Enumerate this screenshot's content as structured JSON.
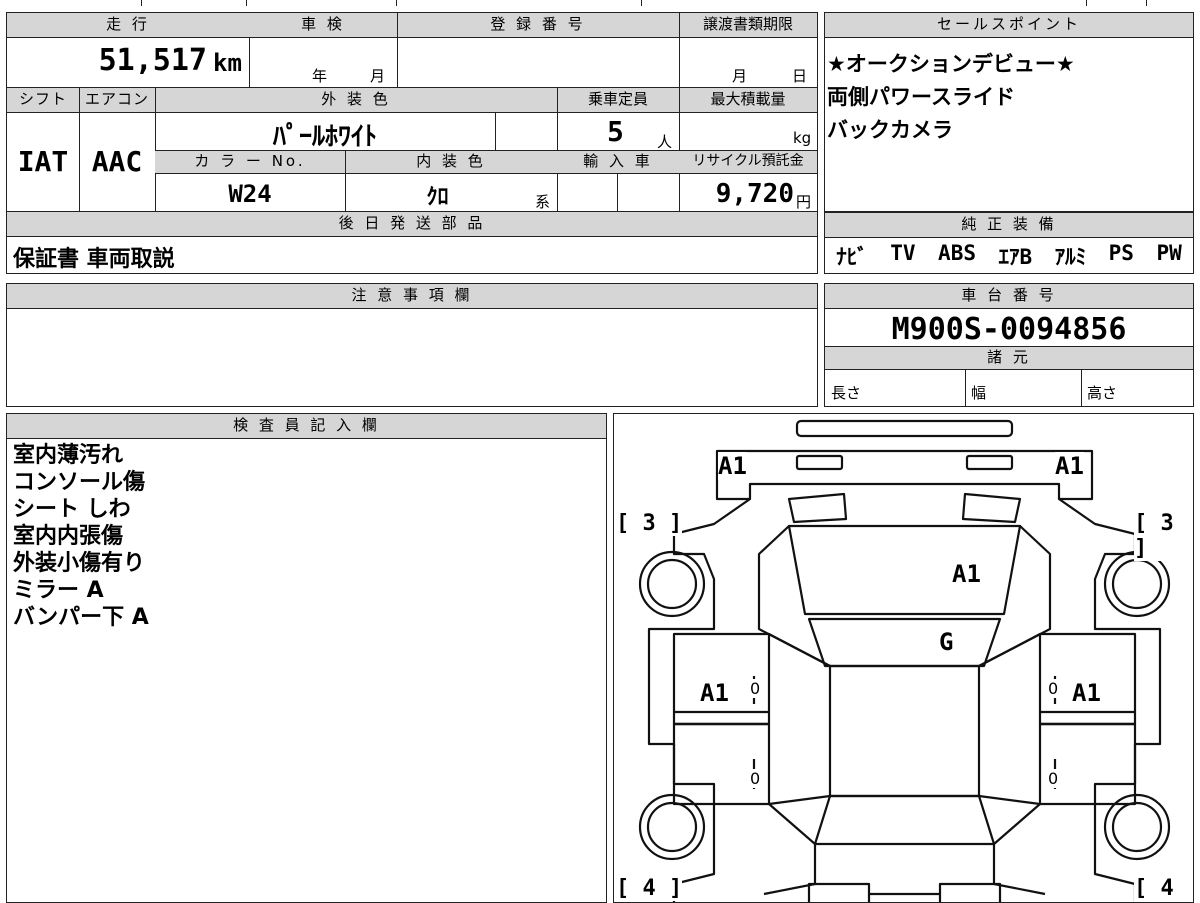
{
  "top": {
    "mileage_label": "走 行",
    "mileage_value": "51,517",
    "mileage_unit": "km",
    "shaken_label": "車 検",
    "shaken_year": "年",
    "shaken_month": "月",
    "reg_label": "登 録 番 号",
    "transfer_label": "譲渡書類期限",
    "transfer_month": "月",
    "transfer_day": "日",
    "shift_label": "シフト",
    "shift_value": "IAT",
    "ac_label": "エアコン",
    "ac_value": "AAC",
    "ext_color_label": "外 装 色",
    "ext_color_value": "ﾊﾟｰﾙﾎﾜｲﾄ",
    "capacity_label": "乗車定員",
    "capacity_value": "5",
    "capacity_unit": "人",
    "max_load_label": "最大積載量",
    "max_load_unit": "kg",
    "color_no_label": "カ ラ ー No.",
    "color_no_value": "W24",
    "int_color_label": "内 装 色",
    "int_color_value": "ｸﾛ",
    "int_color_suffix": "系",
    "import_label": "輸 入 車",
    "recycle_label": "リサイクル預託金",
    "recycle_value": "9,720",
    "recycle_unit": "円",
    "later_parts_label": "後 日 発 送 部 品",
    "later_parts_value": "保証書 車両取説"
  },
  "sales": {
    "label": "セールスポイント",
    "lines": [
      "★オークションデビュー★",
      "両側パワースライド",
      "バックカメラ"
    ]
  },
  "equipment": {
    "label": "純 正 装 備",
    "items": [
      "ﾅﾋﾞ",
      "TV",
      "ABS",
      "ｴｱB",
      "ｱﾙﾐ",
      "PS",
      "PW"
    ]
  },
  "caution": {
    "label": "注 意 事 項 欄"
  },
  "chassis": {
    "label": "車 台 番 号",
    "value": "M900S-0094856",
    "spec_label": "諸 元",
    "length_label": "長さ",
    "width_label": "幅",
    "height_label": "高さ"
  },
  "inspector": {
    "label": "検 査 員 記 入 欄",
    "notes": [
      "室内薄汚れ",
      "コンソール傷",
      "シート しわ",
      "室内内張傷",
      "外装小傷有り",
      "ミラー A",
      "バンパー下 A"
    ]
  },
  "diagram": {
    "front_left": "A1",
    "front_right": "A1",
    "left_front_fender": "[ 3 ]",
    "right_front_fender": "[ 3 ]",
    "hood": "A1",
    "windshield": "G",
    "left_door": "A1",
    "right_door": "A1",
    "left_door_0a": "0",
    "right_door_0a": "0",
    "left_door_0b": "0",
    "right_door_0b": "0",
    "left_rear": "[ 4 ]",
    "right_rear": "[ 4 ]"
  }
}
